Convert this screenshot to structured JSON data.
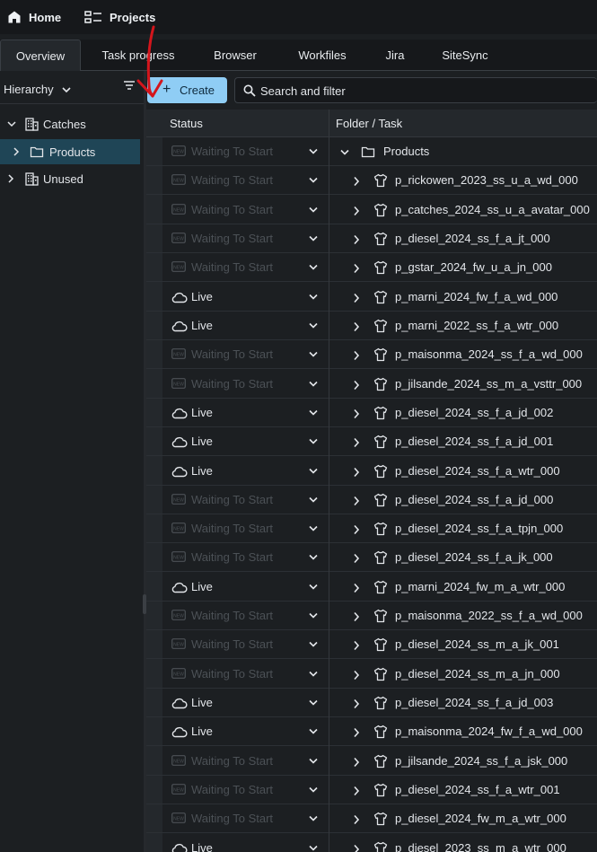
{
  "nav": {
    "home_label": "Home",
    "projects_label": "Projects"
  },
  "tabs": [
    {
      "label": "Overview",
      "active": true
    },
    {
      "label": "Task progress",
      "active": false
    },
    {
      "label": "Browser",
      "active": false
    },
    {
      "label": "Workfiles",
      "active": false
    },
    {
      "label": "Jira",
      "active": false
    },
    {
      "label": "SiteSync",
      "active": false
    }
  ],
  "hierarchy": {
    "mode_label": "Hierarchy",
    "items": [
      {
        "label": "Catches",
        "icon": "building-icon",
        "expanded": true,
        "selected": false
      },
      {
        "label": "Products",
        "icon": "folder-icon",
        "expanded": false,
        "selected": true
      },
      {
        "label": "Unused",
        "icon": "building-icon",
        "expanded": false,
        "selected": false
      }
    ]
  },
  "toolbar": {
    "create_label": "Create",
    "search_placeholder": "Search and filter"
  },
  "table": {
    "headers": {
      "status": "Status",
      "folder_task": "Folder / Task"
    },
    "rows": [
      {
        "status": "Waiting To Start",
        "name": "Products",
        "type": "folder-icon",
        "expanded": true
      },
      {
        "status": "Waiting To Start",
        "name": "p_rickowen_2023_ss_u_a_wd_000",
        "type": "shirt-icon"
      },
      {
        "status": "Waiting To Start",
        "name": "p_catches_2024_ss_u_a_avatar_000",
        "type": "shirt-icon"
      },
      {
        "status": "Waiting To Start",
        "name": "p_diesel_2024_ss_f_a_jt_000",
        "type": "shirt-icon"
      },
      {
        "status": "Waiting To Start",
        "name": "p_gstar_2024_fw_u_a_jn_000",
        "type": "shirt-icon"
      },
      {
        "status": "Live",
        "name": "p_marni_2024_fw_f_a_wd_000",
        "type": "shirt-icon"
      },
      {
        "status": "Live",
        "name": "p_marni_2022_ss_f_a_wtr_000",
        "type": "shirt-icon"
      },
      {
        "status": "Waiting To Start",
        "name": "p_maisonma_2024_ss_f_a_wd_000",
        "type": "shirt-icon"
      },
      {
        "status": "Waiting To Start",
        "name": "p_jilsande_2024_ss_m_a_vsttr_000",
        "type": "shirt-icon"
      },
      {
        "status": "Live",
        "name": "p_diesel_2024_ss_f_a_jd_002",
        "type": "shirt-icon"
      },
      {
        "status": "Live",
        "name": "p_diesel_2024_ss_f_a_jd_001",
        "type": "shirt-icon"
      },
      {
        "status": "Live",
        "name": "p_diesel_2024_ss_f_a_wtr_000",
        "type": "shirt-icon"
      },
      {
        "status": "Waiting To Start",
        "name": "p_diesel_2024_ss_f_a_jd_000",
        "type": "shirt-icon"
      },
      {
        "status": "Waiting To Start",
        "name": "p_diesel_2024_ss_f_a_tpjn_000",
        "type": "shirt-icon"
      },
      {
        "status": "Waiting To Start",
        "name": "p_diesel_2024_ss_f_a_jk_000",
        "type": "shirt-icon"
      },
      {
        "status": "Live",
        "name": "p_marni_2024_fw_m_a_wtr_000",
        "type": "shirt-icon"
      },
      {
        "status": "Waiting To Start",
        "name": "p_maisonma_2022_ss_f_a_wd_000",
        "type": "shirt-icon"
      },
      {
        "status": "Waiting To Start",
        "name": "p_diesel_2024_ss_m_a_jk_001",
        "type": "shirt-icon"
      },
      {
        "status": "Waiting To Start",
        "name": "p_diesel_2024_ss_m_a_jn_000",
        "type": "shirt-icon"
      },
      {
        "status": "Live",
        "name": "p_diesel_2024_ss_f_a_jd_003",
        "type": "shirt-icon"
      },
      {
        "status": "Live",
        "name": "p_maisonma_2024_fw_f_a_wd_000",
        "type": "shirt-icon"
      },
      {
        "status": "Waiting To Start",
        "name": "p_jilsande_2024_ss_f_a_jsk_000",
        "type": "shirt-icon"
      },
      {
        "status": "Waiting To Start",
        "name": "p_diesel_2024_ss_f_a_wtr_001",
        "type": "shirt-icon"
      },
      {
        "status": "Waiting To Start",
        "name": "p_diesel_2024_fw_m_a_wtr_000",
        "type": "shirt-icon"
      },
      {
        "status": "Live",
        "name": "p_diesel_2023_ss_m_a_wtr_000",
        "type": "shirt-icon"
      }
    ]
  },
  "colors": {
    "accent": "#8fcdf5",
    "selected_row": "#1f4556",
    "waiting_text": "#4c5156",
    "annotation": "#d4151c"
  }
}
